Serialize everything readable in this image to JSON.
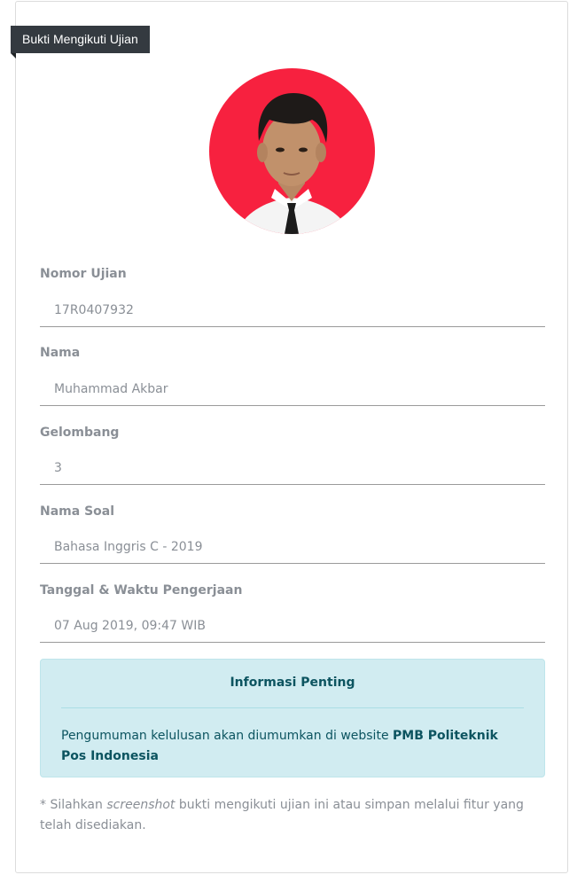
{
  "ribbon": {
    "label": "Bukti Mengikuti Ujian"
  },
  "fields": [
    {
      "label": "Nomor Ujian",
      "value": "17R0407932"
    },
    {
      "label": "Nama",
      "value": "Muhammad Akbar"
    },
    {
      "label": "Gelombang",
      "value": "3"
    },
    {
      "label": "Nama Soal",
      "value": "Bahasa Inggris C - 2019"
    },
    {
      "label": "Tanggal & Waktu Pengerjaan",
      "value": "07 Aug 2019, 09:47 WIB"
    }
  ],
  "info": {
    "title": "Informasi Penting",
    "body_prefix": "Pengumuman kelulusan akan diumumkan di website ",
    "body_bold": "PMB Politeknik Pos Indonesia"
  },
  "note": {
    "prefix": "* Silahkan ",
    "italic": "screenshot",
    "suffix": " bukti mengikuti ujian ini atau simpan melalui fitur yang telah disediakan."
  },
  "colors": {
    "avatar_bg": "#f7213f",
    "ribbon_bg": "#343a40",
    "info_bg": "#d1ecf1",
    "info_text": "#0c5460"
  }
}
